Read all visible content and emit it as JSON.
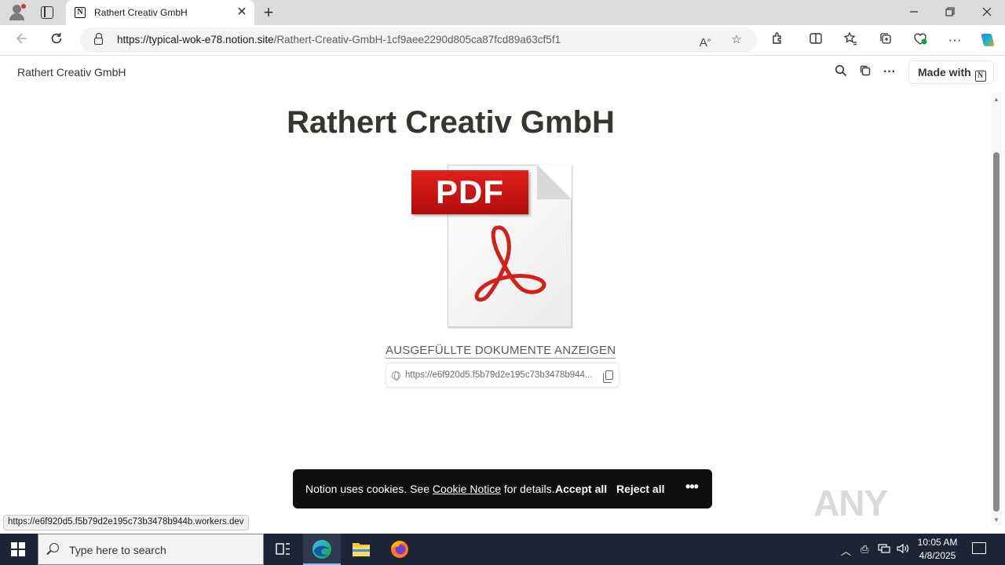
{
  "browser": {
    "tab": {
      "title": "Rathert Creativ GmbH",
      "favicon": "notion-icon",
      "close": "✕"
    },
    "new_tab": "+",
    "window_controls": {
      "minimize": "—",
      "maximize": "❐",
      "close": "✕"
    },
    "address": {
      "host": "https://typical-wok-e78.notion.site",
      "path": "/Rathert-Creativ-GmbH-1cf9aee2290d805ca87fcd89a63cf5f1"
    },
    "status_url": "https://e6f920d5.f5b79d2e195c73b3478b944b.workers.dev"
  },
  "page": {
    "topbar_title": "Rathert Creativ GmbH",
    "made_with": "Made with",
    "made_with_logo": "N",
    "title": "Rathert Creativ GmbH",
    "pdf_label": "PDF",
    "link_title": "AUSGEFÜLLTE DOKUMENTE ANZEIGEN",
    "link_url": "https://e6f920d5.f5b79d2e195c73b3478b944..."
  },
  "cookie_banner": {
    "text_before": "Notion uses cookies. See ",
    "notice_link": "Cookie Notice",
    "text_after": " for details.",
    "accept": "Accept all",
    "reject": "Reject all",
    "more": "•••"
  },
  "watermark": "ANY RUN",
  "taskbar": {
    "search_placeholder": "Type here to search",
    "time": "10:05 AM",
    "date": "4/8/2025"
  },
  "colors": {
    "pdf_red": "#d3201a",
    "cookie_bg": "#0f0f0f",
    "taskbar_bg": "#1c2536"
  }
}
